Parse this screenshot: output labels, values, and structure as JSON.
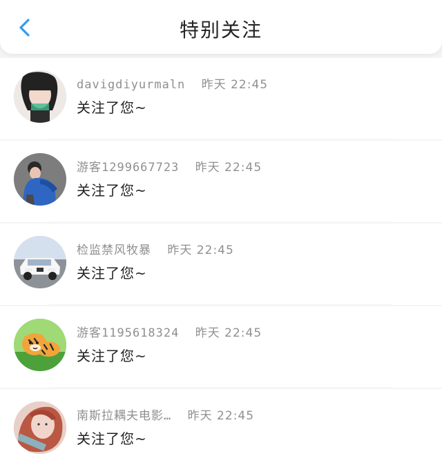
{
  "header": {
    "title": "特别关注",
    "back_icon": "chevron-left-icon",
    "accent": "#2f9bf0"
  },
  "items": [
    {
      "name": "davigdiyurmaln",
      "time": "昨天 22:45",
      "message": "关注了您~",
      "avatar_icon": "user-photo-avatar"
    },
    {
      "name": "游客1299667723",
      "time": "昨天 22:45",
      "message": "关注了您~",
      "avatar_icon": "user-photo-avatar"
    },
    {
      "name": "检监禁风牧暴",
      "time": "昨天 22:45",
      "message": "关注了您~",
      "avatar_icon": "car-avatar"
    },
    {
      "name": "游客1195618324",
      "time": "昨天 22:45",
      "message": "关注了您~",
      "avatar_icon": "tiger-avatar"
    },
    {
      "name": "南斯拉耦夫电影…",
      "time": "昨天 22:45",
      "message": "关注了您~",
      "avatar_icon": "user-photo-avatar"
    }
  ]
}
